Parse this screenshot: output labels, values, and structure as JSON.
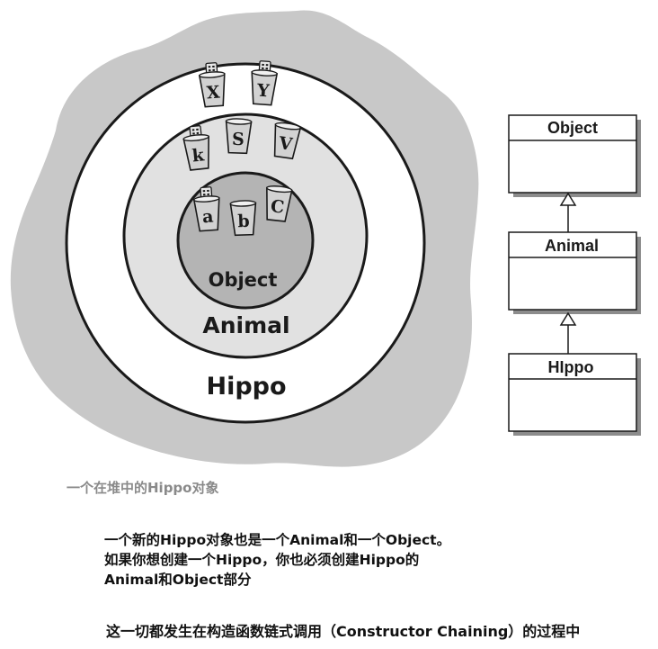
{
  "heap": {
    "rings": {
      "hippo": "Hippo",
      "animal": "Animal",
      "object": "Object"
    },
    "hippo_vars": [
      "X",
      "Y"
    ],
    "animal_vars": [
      "k",
      "S",
      "V"
    ],
    "object_vars": [
      "a",
      "b",
      "C"
    ]
  },
  "uml": {
    "classes": [
      "Object",
      "Animal",
      "HIppo"
    ]
  },
  "captions": {
    "heap": "一个在堆中的Hippo对象",
    "explain_lines": [
      "一个新的Hippo对象也是一个Animal和一个Object。",
      "如果你想创建一个Hippo，你也必须创建Hippo的",
      "Animal和Object部分"
    ],
    "chaining": "这一切都发生在构造函数链式调用（Constructor Chaining）的过程中"
  },
  "colors": {
    "heap_blob": "#c8c8c8",
    "object_ring": "#b4b4b4",
    "animal_ring": "#e1e1e1",
    "hippo_ring": "#ffffff",
    "cup": "#d2d2d2",
    "ink": "#1a1a1a"
  }
}
